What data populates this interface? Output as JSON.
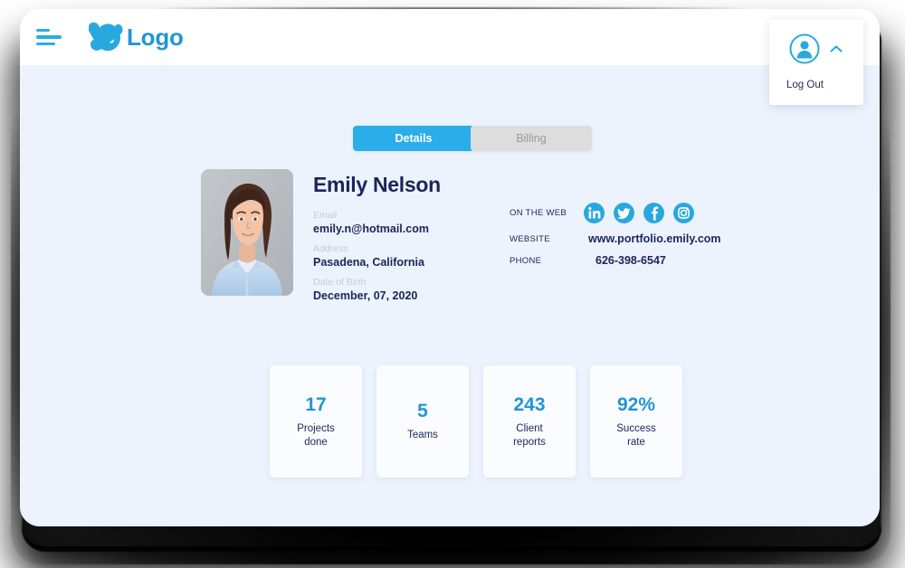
{
  "header": {
    "menu_icon": "hamburger-icon",
    "logo_text": "Logo",
    "logo_icon": "x-swoosh-logo-icon"
  },
  "user_menu": {
    "avatar_icon": "user-avatar-icon",
    "chevron_icon": "chevron-up-icon",
    "logout_label": "Log Out"
  },
  "tabs": [
    {
      "label": "Details",
      "active": true
    },
    {
      "label": "Billing",
      "active": false
    }
  ],
  "profile": {
    "photo_alt": "profile-photo",
    "name": "Emily Nelson",
    "fields": [
      {
        "label": "Email",
        "value": "emily.n@hotmail.com"
      },
      {
        "label": "Address",
        "value": "Pasadena, California"
      },
      {
        "label": "Date of Birth",
        "value": "December, 07, 2020"
      }
    ]
  },
  "web": {
    "on_the_web_label": "ON THE WEB",
    "website_label": "WEBSITE",
    "phone_label": "PHONE",
    "website_value": "www.portfolio.emily.com",
    "phone_value": "626-398-6547",
    "socials": [
      {
        "name": "linkedin-icon"
      },
      {
        "name": "twitter-icon"
      },
      {
        "name": "facebook-icon"
      },
      {
        "name": "instagram-icon"
      }
    ]
  },
  "stats": [
    {
      "value": "17",
      "label": "Projects\ndone"
    },
    {
      "value": "5",
      "label": "Teams"
    },
    {
      "value": "243",
      "label": "Client\nreports"
    },
    {
      "value": "92%",
      "label": "Success\nrate"
    }
  ],
  "colors": {
    "accent_blue": "#2196d6",
    "tab_active_blue": "#2badea",
    "navy": "#1b2559",
    "body_bg": "#ecf3fd",
    "label_gray": "#c2cbdb",
    "tab_inactive_bg": "#dddddd"
  }
}
